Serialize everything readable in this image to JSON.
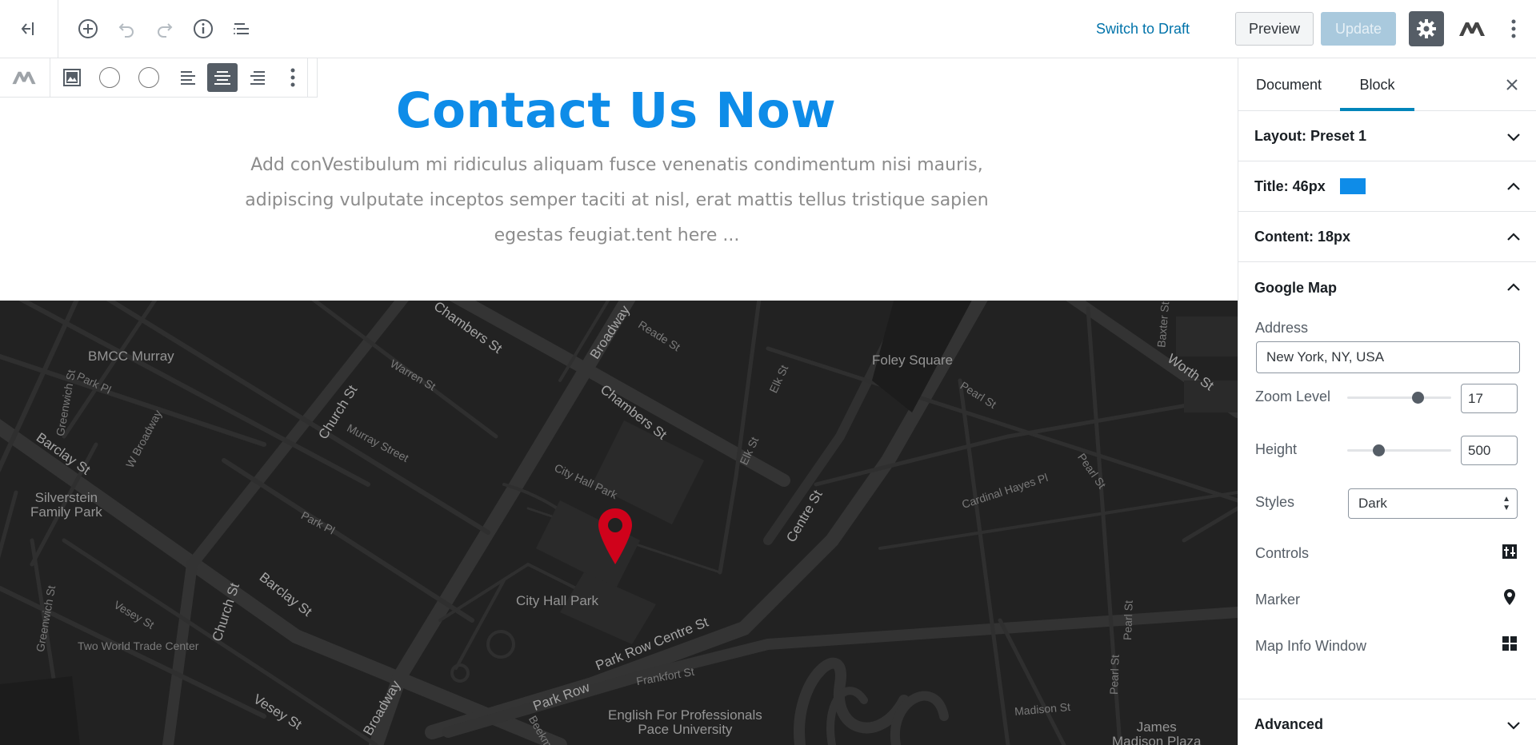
{
  "topbar": {
    "switch_to_draft": "Switch to Draft",
    "preview": "Preview",
    "update": "Update"
  },
  "block": {
    "title": "Contact Us Now",
    "content": "Add conVestibulum mi ridiculus aliquam fusce venenatis condimentum nisi mauris, adipiscing vulputate inceptos semper taciti at nisl, erat mattis tellus tristique sapien egestas feugiat.tent here ...",
    "title_color": "#0e8ce8"
  },
  "map": {
    "labels": {
      "chambers_st_top": "Chambers St",
      "broadway_top": "Broadway",
      "reade_st": "Reade St",
      "bmcc_murray": "BMCC Murray",
      "greenwich_st_top": "Greenwich St",
      "park_pl_left": "Park Pl",
      "warren_st": "Warren St",
      "church_st_top": "Church St",
      "w_broadway": "W Broadway",
      "murray_street": "Murray Street",
      "barclay_st_left": "Barclay St",
      "silverstein": "Silverstein\nFamily Park",
      "park_pl_mid": "Park Pl",
      "chambers_st_mid": "Chambers St",
      "elk_st_top": "Elk St",
      "elk_st_mid": "Elk St",
      "foley_square": "Foley Square",
      "pearl_st_top": "Pearl St",
      "baxter_st": "Baxter St",
      "worth_st": "Worth St",
      "city_hall_park_top": "City Hall Park",
      "centre_st": "Centre St",
      "cardinal_hayes": "Cardinal Hayes Pl",
      "pearl_st_right": "Pearl St",
      "city_hall_park": "City Hall Park",
      "church_st_low": "Church St",
      "barclay_st_low": "Barclay St",
      "greenwich_st_low": "Greenwich St",
      "vesey_st_left": "Vesey St",
      "two_wtc": "Two World Trade Center",
      "park_row_centre": "Park Row  Centre St",
      "frankfort_st": "Frankfort St",
      "park_row": "Park Row",
      "broadway_low": "Broadway",
      "vesey_st_low": "Vesey St",
      "english_pace": "English For Professionals\nPace University",
      "beekman": "Beekman",
      "madison_st": "Madison St",
      "pearl_st_low": "Pearl St",
      "pearl_st_low2": "Pearl St",
      "james_madison": "James\nMadison Plaza"
    },
    "marker_color": "#d0021b"
  },
  "sidebar": {
    "tabs": [
      "Document",
      "Block"
    ],
    "active_tab": "Block",
    "panels": {
      "layout": "Layout: Preset 1",
      "title": "Title: 46px",
      "content": "Content: 18px",
      "google_map": "Google Map",
      "advanced": "Advanced"
    },
    "google_map": {
      "address_label": "Address",
      "address_value": "New York, NY, USA",
      "zoom_label": "Zoom Level",
      "zoom_value": "17",
      "zoom_fraction": 0.7,
      "height_label": "Height",
      "height_value": "500",
      "height_fraction": 0.28,
      "styles_label": "Styles",
      "styles_value": "Dark",
      "controls_label": "Controls",
      "marker_label": "Marker",
      "info_window_label": "Map Info Window"
    }
  }
}
